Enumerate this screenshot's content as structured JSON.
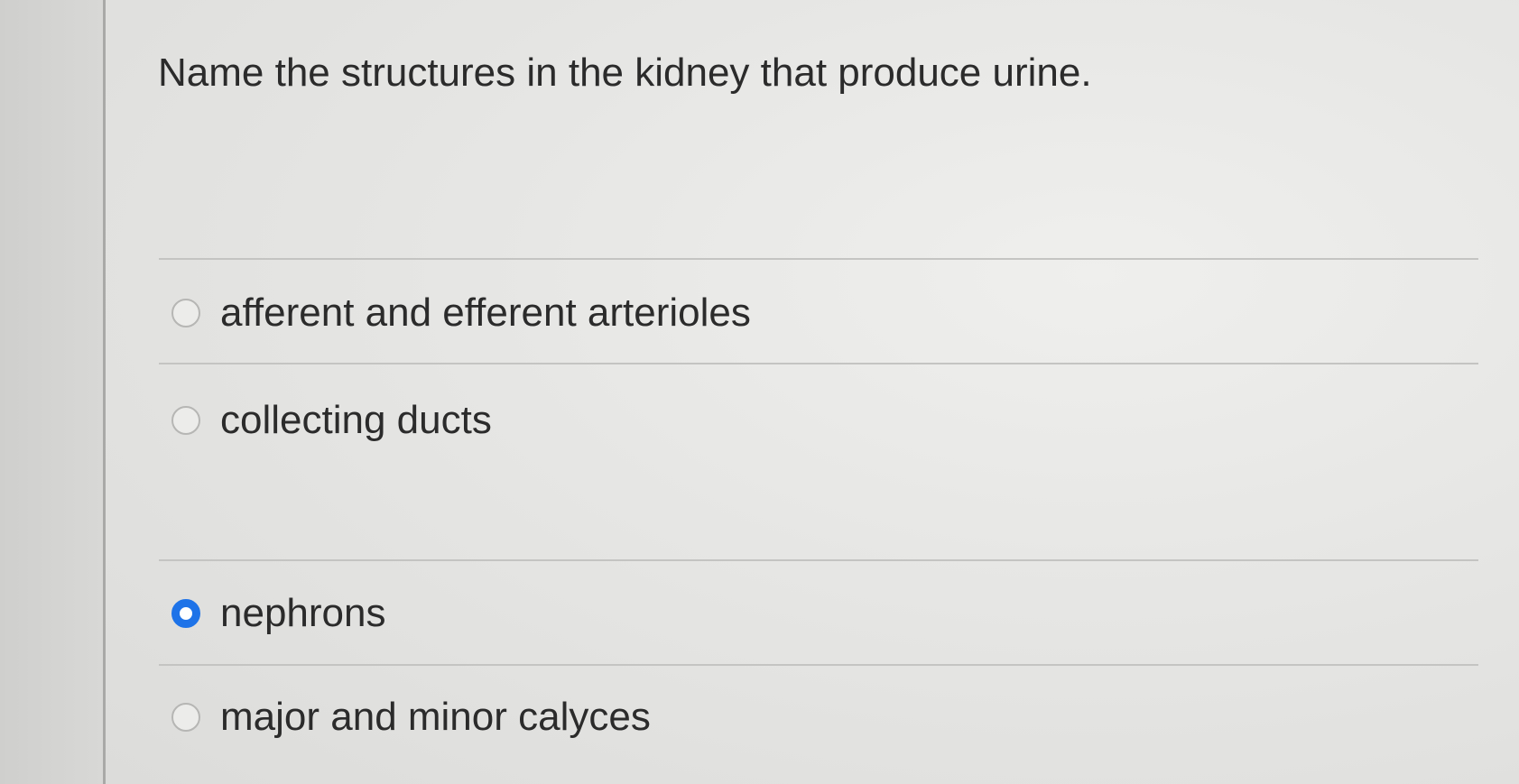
{
  "question": {
    "text": "Name the structures in the kidney that produce urine."
  },
  "options": [
    {
      "label": "afferent and efferent arterioles",
      "selected": false
    },
    {
      "label": "collecting ducts",
      "selected": false
    },
    {
      "label": "nephrons",
      "selected": true
    },
    {
      "label": "major and minor calyces",
      "selected": false
    }
  ],
  "colors": {
    "selected_radio": "#1e73e8",
    "text": "#2b2b2b"
  }
}
